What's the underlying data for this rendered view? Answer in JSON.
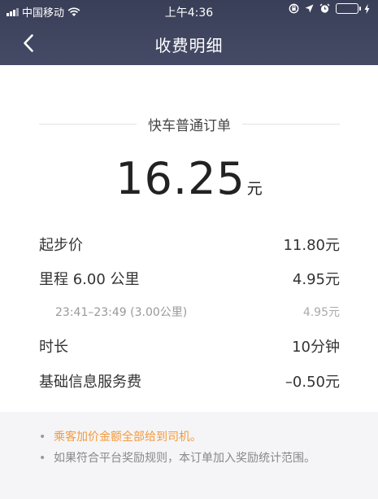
{
  "status_bar": {
    "carrier": "中国移动",
    "time": "上午4:36"
  },
  "nav": {
    "title": "收费明细",
    "back_icon": "chevron-left-icon"
  },
  "order": {
    "type": "快车普通订单",
    "amount": "16.25",
    "currency": "元"
  },
  "fees": [
    {
      "label": "起步价",
      "value": "11.80元"
    },
    {
      "label": "里程 6.00 公里",
      "value": "4.95元"
    },
    {
      "label": "23:41–23:49 (3.00公里)",
      "value": "4.95元"
    },
    {
      "label": "时长",
      "value": "10分钟"
    },
    {
      "label": "基础信息服务费",
      "value": "–0.50元"
    }
  ],
  "notes": [
    "乘客加价金额全部给到司机。",
    "如果符合平台奖励规则，本订单加入奖励统计范围。"
  ],
  "colors": {
    "header": "#3e435d",
    "note_highlight": "#f39a3b",
    "battery": "#4cd964"
  }
}
